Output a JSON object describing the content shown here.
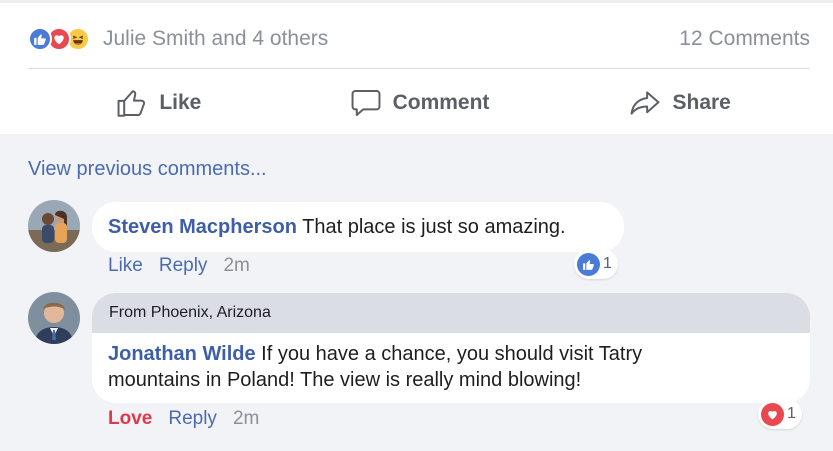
{
  "summary": {
    "reaction_icons": [
      "like-icon",
      "love-icon",
      "haha-icon"
    ],
    "names": "Julie Smith and 4 others",
    "comments_count": "12 Comments"
  },
  "actions": {
    "like": "Like",
    "comment": "Comment",
    "share": "Share"
  },
  "view_previous": "View previous comments...",
  "comments": [
    {
      "author": "Steven Macpherson",
      "text": "That place is just so amazing.",
      "like_label": "Like",
      "reply_label": "Reply",
      "time": "2m",
      "reaction_icon": "like-icon",
      "reaction_count": "1"
    },
    {
      "header": "From Phoenix, Arizona",
      "author": "Jonathan Wilde",
      "text_line1": "If you have a chance, you should visit Tatry",
      "text_line2": "mountains in Poland! The view is really mind blowing!",
      "like_label": "Love",
      "reply_label": "Reply",
      "time": "2m",
      "reaction_icon": "love-icon",
      "reaction_count": "1"
    }
  ],
  "colors": {
    "link": "#4b6bb0",
    "author": "#3f5ea8",
    "love": "#e0394b",
    "like_reaction": "#4a7bd6",
    "love_reaction": "#e9484f",
    "haha_reaction": "#f7c944",
    "comments_bg": "#f2f3f6"
  }
}
